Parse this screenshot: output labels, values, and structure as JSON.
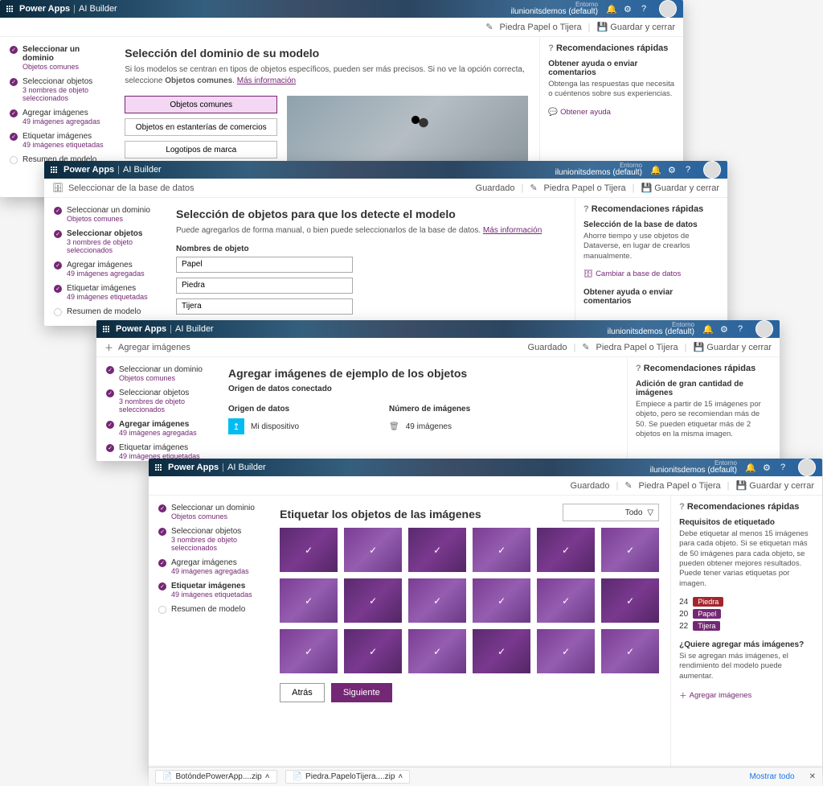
{
  "brand": {
    "app": "Power Apps",
    "module": "AI Builder"
  },
  "env": {
    "label": "Entorno",
    "value": "ilunionitsdemos (default)"
  },
  "toolbar": {
    "save": "Guardar y cerrar",
    "saved": "Guardado",
    "model_name": "Piedra Papel o Tijera",
    "select_db": "Seleccionar de la base de datos",
    "add_images": "Agregar imágenes"
  },
  "steps": {
    "s1": {
      "title": "Seleccionar un dominio",
      "sub": "Objetos comunes"
    },
    "s2": {
      "title": "Seleccionar objetos",
      "sub": "3 nombres de objeto seleccionados"
    },
    "s3": {
      "title": "Agregar imágenes",
      "sub": "49 imágenes agregadas"
    },
    "s4": {
      "title": "Etiquetar imágenes",
      "sub": "49 imágenes etiquetadas"
    },
    "s5": {
      "title": "Resumen de modelo"
    }
  },
  "w1": {
    "title": "Selección del dominio de su modelo",
    "desc_a": "Si los modelos se centran en tipos de objetos específicos, pueden ser más precisos. Si no ve la opción correcta, seleccione ",
    "desc_em": "Objetos comunes",
    "desc_b": ". ",
    "more": "Más información",
    "opts": {
      "o1": "Objetos comunes",
      "o2": "Objetos en estanterías de comercios",
      "o3": "Logotipos de marca"
    },
    "rec_title": "Recomendaciones rápidas",
    "help_t": "Obtener ayuda o enviar comentarios",
    "help_d": "Obtenga las respuestas que necesita o cuéntenos sobre sus experiencias.",
    "help_link": "Obtener ayuda"
  },
  "w2": {
    "title": "Selección de objetos para que los detecte el modelo",
    "desc": "Puede agregarlos de forma manual, o bien puede seleccionarlos de la base de datos. ",
    "more": "Más información",
    "names_label": "Nombres de objeto",
    "names": {
      "n1": "Papel",
      "n2": "Piedra",
      "n3": "Tijera"
    },
    "rec_title": "Recomendaciones rápidas",
    "db_t": "Selección de la base de datos",
    "db_d": "Ahorre tiempo y use objetos de Dataverse, en lugar de crearlos manualmente.",
    "db_link": "Cambiar a base de datos",
    "help_t": "Obtener ayuda o enviar comentarios"
  },
  "w3": {
    "title": "Agregar imágenes de ejemplo de los objetos",
    "sub": "Origen de datos conectado",
    "hdr1": "Origen de datos",
    "hdr2": "Número de imágenes",
    "row_src": "Mi dispositivo",
    "row_count": "49 imágenes",
    "rec_title": "Recomendaciones rápidas",
    "card_t": "Adición de gran cantidad de imágenes",
    "card_d": "Empiece a partir de 15 imágenes por objeto, pero se recomiendan más de 50. Se pueden etiquetar más de 2 objetos en la misma imagen."
  },
  "w4": {
    "title": "Etiquetar los objetos de las imágenes",
    "filter_label": "Todo",
    "back": "Atrás",
    "next": "Siguiente",
    "rec_title": "Recomendaciones rápidas",
    "req_t": "Requisitos de etiquetado",
    "req_d": "Debe etiquetar al menos 15 imágenes para cada objeto. Si se etiquetan más de 50 imágenes para cada objeto, se pueden obtener mejores resultados. Puede tener varias etiquetas por imagen.",
    "counts": {
      "piedra_n": "24",
      "piedra": "Piedra",
      "papel_n": "20",
      "papel": "Papel",
      "tijera_n": "22",
      "tijera": "Tijera"
    },
    "more_t": "¿Quiere agregar más imágenes?",
    "more_d": "Si se agregan más imágenes, el rendimiento del modelo puede aumentar.",
    "more_link": "Agregar imágenes"
  },
  "downloads": {
    "f1": "BotóndePowerApp....zip",
    "f2": "Piedra.PapeloTijera....zip",
    "show_all": "Mostrar todo"
  }
}
